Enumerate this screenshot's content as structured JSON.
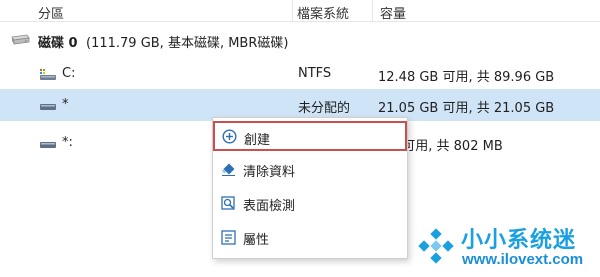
{
  "columns": {
    "partition": "分區",
    "filesystem": "檔案系統",
    "capacity": "容量"
  },
  "disk": {
    "name": "磁碟 0",
    "details": "(111.79 GB, 基本磁碟, MBR磁碟)",
    "icon": "hard-disk-icon"
  },
  "partitions": [
    {
      "label": "C:",
      "filesystem": "NTFS",
      "capacity": "12.48 GB  可用, 共  89.96 GB",
      "icon": "system-drive-icon"
    },
    {
      "label": "*",
      "filesystem": "未分配的",
      "capacity": "21.05 GB  可用, 共  21.05 GB",
      "icon": "drive-icon",
      "selected": true
    },
    {
      "label": "*:",
      "filesystem": "",
      "capacity": "MB  可用, 共  802 MB",
      "icon": "drive-icon"
    }
  ],
  "context_menu": {
    "items": [
      {
        "label": "創建",
        "icon": "plus-circle-icon",
        "highlighted": true
      },
      {
        "label": "清除資料",
        "icon": "eraser-icon"
      },
      {
        "label": "表面檢測",
        "icon": "magnifier-icon"
      },
      {
        "label": "屬性",
        "icon": "properties-icon"
      }
    ]
  },
  "watermark": {
    "title": "小小系统迷",
    "url": "www.ilovext.com"
  },
  "colors": {
    "selected_row": "#cfe4f6",
    "highlight_border": "#c85050",
    "icon_blue": "#2f6fb5",
    "watermark": "#1aa0e0"
  }
}
